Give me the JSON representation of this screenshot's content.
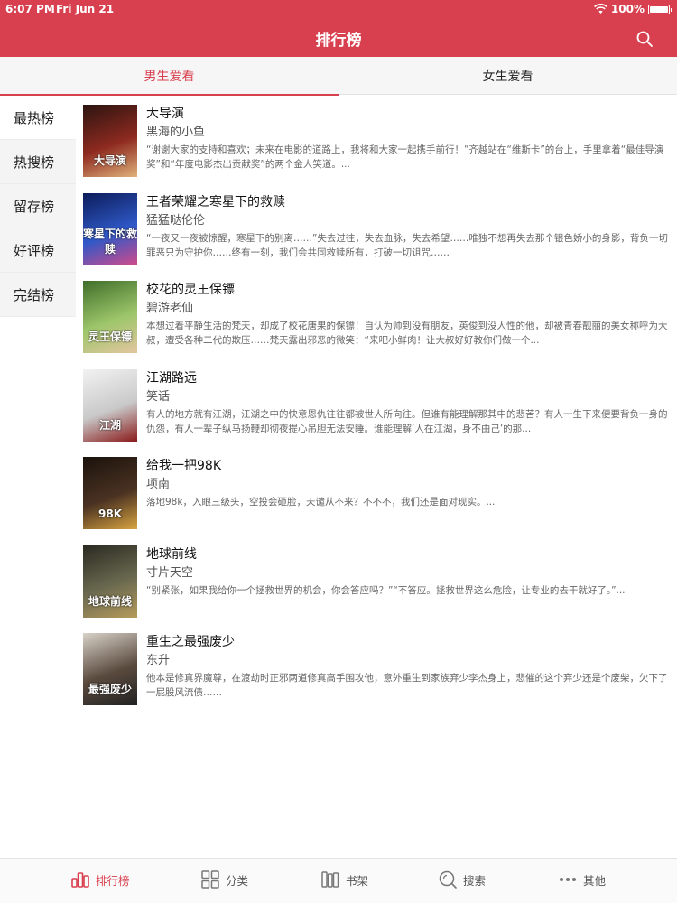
{
  "status": {
    "time": "6:07 PM",
    "date": "Fri Jun 21",
    "battery": "100%"
  },
  "header": {
    "title": "排行榜",
    "search_icon": "search-icon"
  },
  "tabs": [
    {
      "label": "男生爱看",
      "active": true
    },
    {
      "label": "女生爱看",
      "active": false
    }
  ],
  "categories": [
    {
      "label": "最热榜",
      "active": true
    },
    {
      "label": "热搜榜",
      "active": false
    },
    {
      "label": "留存榜",
      "active": false
    },
    {
      "label": "好评榜",
      "active": false
    },
    {
      "label": "完结榜",
      "active": false
    }
  ],
  "books": [
    {
      "title": "大导演",
      "author": "黑海的小鱼",
      "desc": "“谢谢大家的支持和喜欢；未来在电影的道路上，我将和大家一起携手前行！”齐越站在“维斯卡”的台上，手里拿着“最佳导演奖”和“年度电影杰出贡献奖”的两个金人笑道。...",
      "cover_text": "大导演",
      "cover_colors": [
        "#2b1410",
        "#8e2a20",
        "#e0b27a"
      ]
    },
    {
      "title": "王者荣耀之寒星下的救赎",
      "author": "猛猛哒伦伦",
      "desc": "“一夜又一夜被惊醒，寒星下的别离……”失去过往，失去血脉，失去希望……唯独不想再失去那个银色娇小的身影，背负一切罪恶只为守护你……终有一刻，我们会共同救赎所有，打破一切诅咒……",
      "cover_text": "寒星下的救赎",
      "cover_colors": [
        "#0c1c5a",
        "#2f59c8",
        "#d24a8a"
      ]
    },
    {
      "title": "校花的灵王保镖",
      "author": "碧游老仙",
      "desc": "本想过着平静生活的梵天，却成了校花唐果的保镖！自认为帅到没有朋友，英俊到没人性的他，却被青春靓丽的美女称呼为大叔，遭受各种二代的欺压……梵天露出邪恶的微笑：“来吧小鲜肉！让大叔好好教你们做一个...",
      "cover_text": "灵王保镖",
      "cover_colors": [
        "#3f6e2a",
        "#9dc66a",
        "#e3c6a0"
      ]
    },
    {
      "title": "江湖路远",
      "author": "笑话",
      "desc": "有人的地方就有江湖，江湖之中的快意恩仇往往都被世人所向往。但谁有能理解那其中的悲苦？有人一生下来便要背负一身的仇怨，有人一辈子纵马扬鞭却彻夜提心吊胆无法安睡。谁能理解‘人在江湖，身不由己’的那...",
      "cover_text": "江湖",
      "cover_colors": [
        "#f2f2f2",
        "#c9c9c9",
        "#8a1a1a"
      ]
    },
    {
      "title": "给我一把98K",
      "author": "项南",
      "desc": "落地98k，入眼三级头，空投会砸脸，天谴从不来？不不不，我们还是面对现实。...",
      "cover_text": "98K",
      "cover_colors": [
        "#1a120c",
        "#4a3222",
        "#d8a440"
      ]
    },
    {
      "title": "地球前线",
      "author": "寸片天空",
      "desc": "“别紧张，如果我给你一个拯救世界的机会，你会答应吗？”“不答应。拯救世界这么危险，让专业的去干就好了。”...",
      "cover_text": "地球前线",
      "cover_colors": [
        "#2a2a22",
        "#6b6a50",
        "#b59a5a"
      ]
    },
    {
      "title": "重生之最强废少",
      "author": "东升",
      "desc": "他本是修真界魔尊，在渡劫时正邪两道修真高手围攻他，意外重生到家族弃少李杰身上，悲催的这个弃少还是个废柴，欠下了一屁股风流债……",
      "cover_text": "最强废少",
      "cover_colors": [
        "#d8d2c8",
        "#5a4a3e",
        "#222222"
      ]
    }
  ],
  "tabbar": [
    {
      "label": "排行榜",
      "icon": "ranking-icon",
      "active": true
    },
    {
      "label": "分类",
      "icon": "grid-icon",
      "active": false
    },
    {
      "label": "书架",
      "icon": "bookshelf-icon",
      "active": false
    },
    {
      "label": "搜索",
      "icon": "search-icon",
      "active": false
    },
    {
      "label": "其他",
      "icon": "more-icon",
      "active": false
    }
  ],
  "colors": {
    "accent": "#d9404f"
  }
}
